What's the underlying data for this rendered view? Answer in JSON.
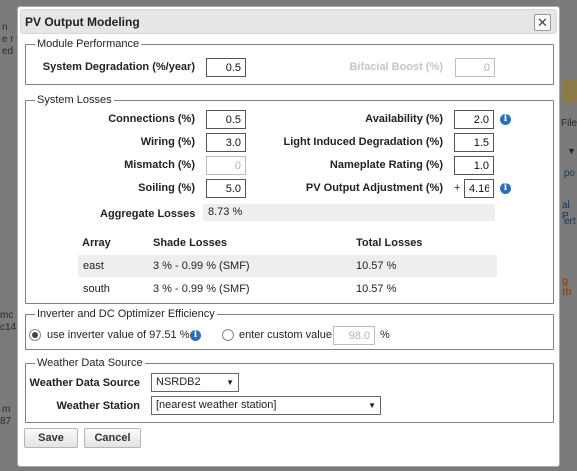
{
  "background": {
    "left_fragments": [
      "n",
      "e r",
      "ed",
      "mc",
      "c14",
      "m",
      "87"
    ],
    "right_fragments": [
      "File",
      "po",
      "al P",
      "ert",
      "g th"
    ]
  },
  "dialog": {
    "title": "PV Output Modeling",
    "close_glyph": "✕"
  },
  "module_performance": {
    "legend": "Module Performance",
    "degradation_label": "System Degradation (%/year)",
    "degradation_value": "0.5",
    "bifacial_label": "Bifacial Boost (%)",
    "bifacial_value": "0"
  },
  "system_losses": {
    "legend": "System Losses",
    "connections_label": "Connections (%)",
    "connections_value": "0.5",
    "wiring_label": "Wiring (%)",
    "wiring_value": "3.0",
    "mismatch_label": "Mismatch (%)",
    "mismatch_value": "0",
    "soiling_label": "Soiling (%)",
    "soiling_value": "5.0",
    "availability_label": "Availability (%)",
    "availability_value": "2.0",
    "lid_label": "Light Induced Degradation (%)",
    "lid_value": "1.5",
    "nameplate_label": "Nameplate Rating (%)",
    "nameplate_value": "1.0",
    "pv_adjust_label": "PV Output Adjustment (%)",
    "pv_adjust_sign": "+",
    "pv_adjust_value": "4.16",
    "aggregate_label": "Aggregate Losses",
    "aggregate_value": "8.73 %",
    "table_headers": [
      "Array",
      "Shade Losses",
      "Total Losses"
    ],
    "table_rows": [
      {
        "array": "east",
        "shade": "3 % - 0.99 % (SMF)",
        "total": "10.57 %"
      },
      {
        "array": "south",
        "shade": "3 % - 0.99 % (SMF)",
        "total": "10.57 %"
      }
    ]
  },
  "inverter": {
    "legend": "Inverter and DC Optimizer Efficiency",
    "use_inverter_label": "use inverter value of 97.51 %",
    "custom_label": "enter custom value",
    "custom_value": "98.0",
    "custom_unit": "%"
  },
  "weather": {
    "legend": "Weather Data Source",
    "source_label": "Weather Data Source",
    "source_value": "NSRDB2",
    "station_label": "Weather Station",
    "station_value": "[nearest weather station]"
  },
  "buttons": {
    "save": "Save",
    "cancel": "Cancel"
  },
  "icons": {
    "info": "info-icon",
    "dropdown": "dropdown-arrow-icon",
    "arrow_glyph": "▼"
  },
  "colors": {
    "info_icon": "#2a6fbd",
    "overlay": "#7a7a7a"
  }
}
